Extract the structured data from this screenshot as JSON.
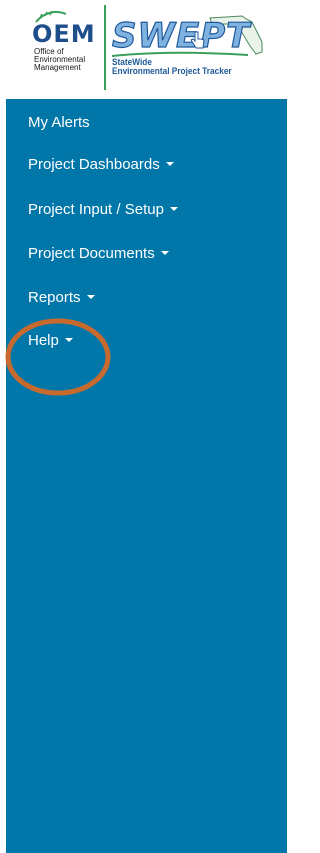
{
  "header": {
    "oem_logo": {
      "wordmark": "OEM",
      "line1": "Office of",
      "line2": "Environmental",
      "line3": "Management"
    },
    "swept_logo": {
      "wordmark": "SWEPT",
      "line1": "StateWide",
      "line2": "Environmental Project Tracker"
    }
  },
  "sidebar": {
    "background_color": "#0077a8",
    "items": [
      {
        "label": "My Alerts",
        "has_dropdown": false
      },
      {
        "label": "Project Dashboards",
        "has_dropdown": true
      },
      {
        "label": "Project Input / Setup",
        "has_dropdown": true
      },
      {
        "label": "Project Documents",
        "has_dropdown": true
      },
      {
        "label": "Reports",
        "has_dropdown": true
      },
      {
        "label": "Help",
        "has_dropdown": true
      }
    ]
  },
  "annotation": {
    "shape": "circle",
    "color": "#c8692e",
    "target": "Help"
  }
}
